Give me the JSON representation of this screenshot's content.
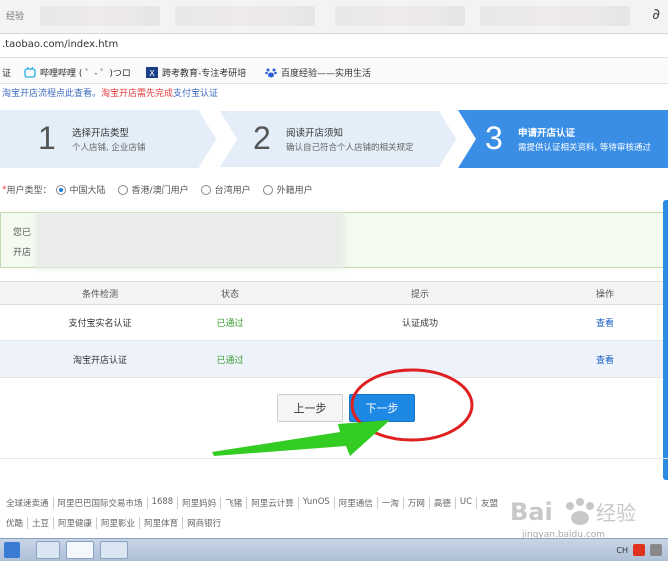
{
  "browser": {
    "tab_title": "经验",
    "url": ".taobao.com/index.htm",
    "bookmarks": [
      {
        "label": "证"
      },
      {
        "label": "哔哩哔哩 ( ゜- ゜)つロ"
      },
      {
        "label": "跨考教育-专注考研培"
      },
      {
        "label": "百度经验——实用生活"
      }
    ]
  },
  "notice": {
    "text": "淘宝开店流程点此查看。",
    "red_text": "淘宝开店需先完成",
    "link_text": "支付宝认证"
  },
  "steps": [
    {
      "num": "1",
      "title": "选择开店类型",
      "sub": "个人店铺, 企业店铺"
    },
    {
      "num": "2",
      "title": "阅读开店须知",
      "sub": "确认自己符合个人店铺的相关规定"
    },
    {
      "num": "3",
      "title": "申请开店认证",
      "sub": "需提供认证相关资料, 等待审核通过"
    }
  ],
  "user_type": {
    "label": "用户类型：",
    "required_mark": "*",
    "options": [
      "中国大陆",
      "香港/澳门用户",
      "台湾用户",
      "外籍用户"
    ],
    "selected": "中国大陆"
  },
  "infobox": {
    "line1": "您已",
    "line2": "开店"
  },
  "table": {
    "headers": [
      "条件检测",
      "状态",
      "提示",
      "操作"
    ],
    "rows": [
      {
        "name": "支付宝实名认证",
        "status": "已通过",
        "hint": "认证成功",
        "action": "查看"
      },
      {
        "name": "淘宝开店认证",
        "status": "已通过",
        "hint": "",
        "action": "查看"
      }
    ]
  },
  "buttons": {
    "prev": "上一步",
    "next": "下一步"
  },
  "footer": {
    "row1": [
      "全球速卖通",
      "阿里巴巴国际交易市场",
      "1688",
      "阿里妈妈",
      "飞猪",
      "阿里云计算",
      "YunOS",
      "阿里通信",
      "一淘",
      "万网",
      "高德",
      "UC",
      "友盟"
    ],
    "row2": [
      "优酷",
      "土豆",
      "阿里健康",
      "阿里影业",
      "阿里体育",
      "网商银行"
    ]
  },
  "watermark": {
    "url": "jingyan.baidu.com"
  },
  "taskbar": {
    "lang": "CH"
  },
  "colors": {
    "step_active": "#3a8ee6",
    "step_inactive": "#e3eef9",
    "next_button": "#1e88e5",
    "pass_green": "#3b9d30",
    "link_blue": "#1a5fc4",
    "annotation_red": "#e02020",
    "annotation_green": "#33cc22"
  }
}
